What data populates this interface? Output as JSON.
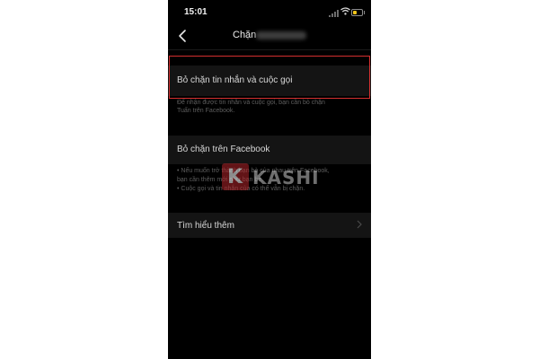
{
  "status_bar": {
    "time": "15:01",
    "icons": [
      "signal-icon",
      "wifi-icon",
      "battery-icon"
    ],
    "battery_color": "#f0c419"
  },
  "nav": {
    "back_icon": "chevron-left-icon",
    "title": "Chặn"
  },
  "sections": {
    "block_messages": {
      "label": "Bỏ chặn tin nhắn và cuộc gọi",
      "description": [
        "Để nhận được tin nhắn và cuộc gọi, bạn cần bỏ chặn",
        "Tuấn trên Facebook."
      ]
    },
    "block_facebook": {
      "label": "Bỏ chặn trên Facebook",
      "bullets": [
        "• Nếu muốn trở thành bạn bè của nhau trên Facebook,",
        "  bạn cần thêm         mới như bạn bè.",
        "• Cuộc gọi và tin nhắn của        có thể vẫn bị chặn."
      ]
    },
    "learn_more": {
      "label": "Tìm hiểu thêm",
      "icon": "chevron-right-icon"
    }
  },
  "highlight_color": "#d32f2f",
  "watermark": {
    "letter": "K",
    "text": "KASHI",
    "color": "#b3262b"
  }
}
